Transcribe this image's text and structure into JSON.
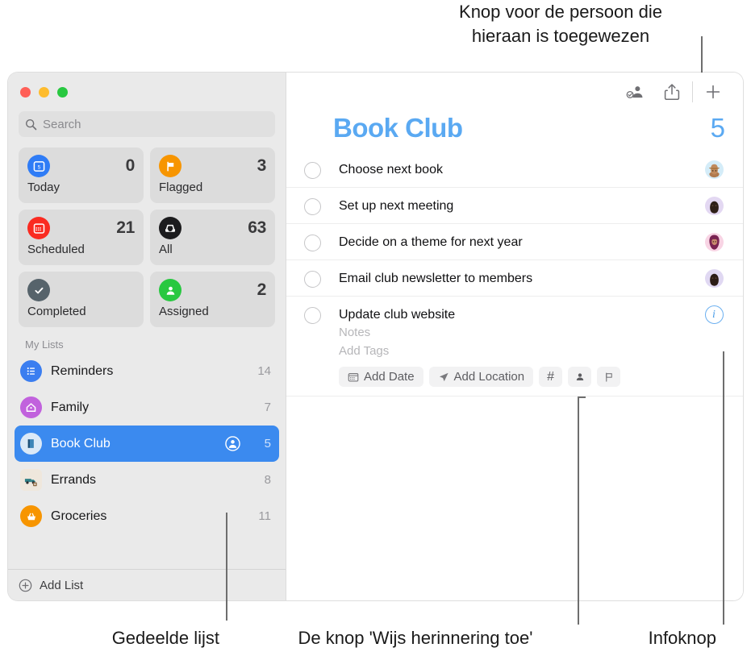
{
  "annotations": {
    "top": "Knop voor de persoon die\nhieraan is toegewezen",
    "bottom_left": "Gedeelde lijst",
    "bottom_mid": "De knop 'Wijs herinnering toe'",
    "bottom_right": "Infoknop"
  },
  "window": {
    "traffic_lights": [
      "close",
      "minimize",
      "zoom"
    ]
  },
  "sidebar": {
    "search": {
      "placeholder": "Search",
      "value": ""
    },
    "tiles": [
      {
        "label": "Today",
        "count": "0",
        "icon": "calendar-today-icon",
        "color": "#2f7cf6"
      },
      {
        "label": "Flagged",
        "count": "3",
        "icon": "flag-icon",
        "color": "#f79500"
      },
      {
        "label": "Scheduled",
        "count": "21",
        "icon": "calendar-icon",
        "color": "#fa2b21"
      },
      {
        "label": "All",
        "count": "63",
        "icon": "inbox-icon",
        "color": "#1c1c1e"
      },
      {
        "label": "Completed",
        "count": "",
        "icon": "checkmark-icon",
        "color": "#56636b"
      },
      {
        "label": "Assigned",
        "count": "2",
        "icon": "person-icon",
        "color": "#28c840"
      }
    ],
    "section_header": "My Lists",
    "lists": [
      {
        "name": "Reminders",
        "count": "14",
        "icon": "list-bullet-icon",
        "color": "#3b7ef0",
        "shared": false,
        "selected": false
      },
      {
        "name": "Family",
        "count": "7",
        "icon": "house-icon",
        "color": "#c162dd",
        "shared": false,
        "selected": false
      },
      {
        "name": "Book Club",
        "count": "5",
        "icon": "book-icon",
        "color": "#dbe9f7",
        "shared": true,
        "selected": true
      },
      {
        "name": "Errands",
        "count": "8",
        "icon": "truck-icon",
        "color": "# efe7dc",
        "shared": false,
        "selected": false
      },
      {
        "name": "Groceries",
        "count": "11",
        "icon": "basket-icon",
        "color": "#f79500",
        "shared": false,
        "selected": false
      }
    ],
    "add_list_label": "Add List"
  },
  "detail": {
    "toolbar": [
      {
        "name": "assigned-to-me-button",
        "icon": "person-checkmark-icon"
      },
      {
        "name": "share-button",
        "icon": "share-icon"
      },
      {
        "name": "add-reminder-button",
        "icon": "plus-icon"
      }
    ],
    "title": "Book Club",
    "count": "5",
    "accent": "#5aa9f2",
    "reminders": [
      {
        "text": "Choose next book",
        "assignee": "avatar-hat",
        "expanded": false
      },
      {
        "text": "Set up next meeting",
        "assignee": "avatar-beard",
        "expanded": false
      },
      {
        "text": "Decide on a theme for next year",
        "assignee": "avatar-headscarf",
        "expanded": false
      },
      {
        "text": "Email club newsletter to members",
        "assignee": "avatar-beard2",
        "expanded": false
      },
      {
        "text": "Update club website",
        "assignee": "info-button",
        "expanded": true,
        "notes_placeholder": "Notes",
        "tags_placeholder": "Add Tags",
        "chips": [
          {
            "label": "Add Date",
            "icon": "calendar-icon",
            "name": "add-date-chip"
          },
          {
            "label": "Add Location",
            "icon": "location-arrow-icon",
            "name": "add-location-chip"
          },
          {
            "label": "#",
            "icon": "hash-icon",
            "name": "add-tag-chip"
          },
          {
            "label": "",
            "icon": "person-icon",
            "name": "assign-reminder-chip"
          },
          {
            "label": "",
            "icon": "flag-outline-icon",
            "name": "flag-chip"
          }
        ]
      }
    ]
  }
}
